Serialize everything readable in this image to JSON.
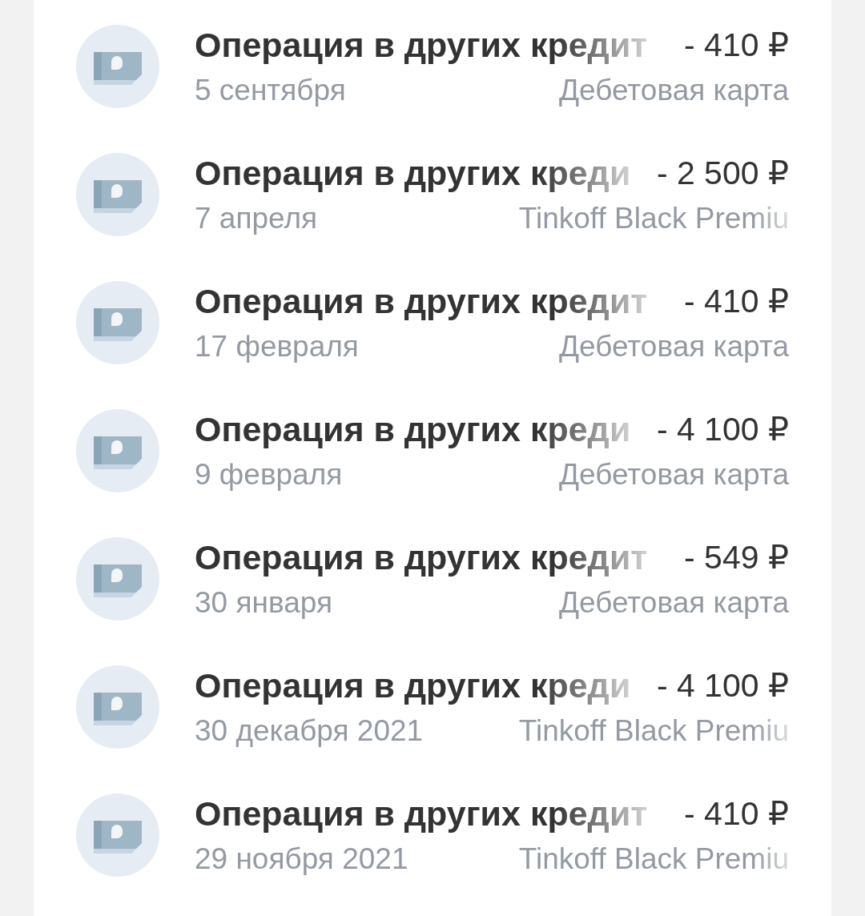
{
  "transactions": [
    {
      "title": "Операция в других кредит",
      "amount": "- 410 ₽",
      "date": "5 сентября",
      "account": "Дебетовая карта",
      "account_faded": false
    },
    {
      "title": "Операция в других креди",
      "amount": "- 2 500 ₽",
      "date": "7 апреля",
      "account": "Tinkoff Black Premiu",
      "account_faded": true
    },
    {
      "title": "Операция в других кредит",
      "amount": "- 410 ₽",
      "date": "17 февраля",
      "account": "Дебетовая карта",
      "account_faded": false
    },
    {
      "title": "Операция в других креди",
      "amount": "- 4 100 ₽",
      "date": "9 февраля",
      "account": "Дебетовая карта",
      "account_faded": false
    },
    {
      "title": "Операция в других кредит",
      "amount": "- 549 ₽",
      "date": "30 января",
      "account": "Дебетовая карта",
      "account_faded": false
    },
    {
      "title": "Операция в других креди",
      "amount": "- 4 100 ₽",
      "date": "30 декабря 2021",
      "account": "Tinkoff Black Premiu",
      "account_faded": true
    },
    {
      "title": "Операция в других кредит",
      "amount": "- 410 ₽",
      "date": "29 ноября 2021",
      "account": "Tinkoff Black Premiu",
      "account_faded": true
    }
  ]
}
